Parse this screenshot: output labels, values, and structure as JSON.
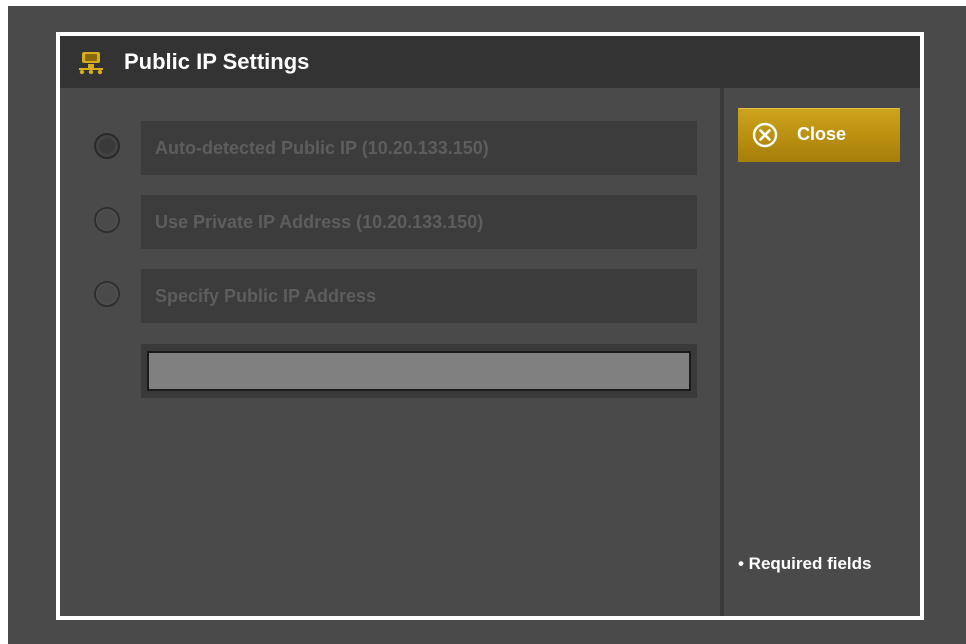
{
  "dialog": {
    "title": "Public IP Settings",
    "title_icon": "network-computer-icon",
    "accent_color": "#c9a016"
  },
  "options": [
    {
      "label": "Auto-detected Public IP (10.20.133.150)",
      "selected": true
    },
    {
      "label": "Use Private IP Address (10.20.133.150)",
      "selected": false
    },
    {
      "label": "Specify Public IP Address",
      "selected": false
    }
  ],
  "ip_input": {
    "value": "",
    "placeholder": ""
  },
  "sidebar": {
    "close_label": "Close",
    "close_icon": "close-circle-icon",
    "required_note": "• Required fields"
  }
}
